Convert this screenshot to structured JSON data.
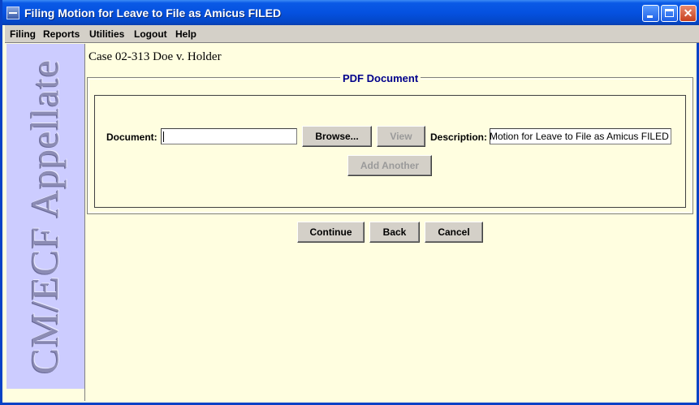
{
  "window": {
    "title": "Filing Motion for Leave to File as Amicus FILED"
  },
  "menu": {
    "items": [
      "Filing",
      "Reports",
      "Utilities",
      "Logout",
      "Help"
    ]
  },
  "sidebar": {
    "brand_text": "CM/ECF Appellate"
  },
  "case": {
    "title": "Case 02-313 Doe v. Holder"
  },
  "pdf_group": {
    "legend": "PDF Document",
    "document_label": "Document:",
    "document_value": "",
    "browse_label": "Browse...",
    "view_label": "View",
    "description_label": "Description:",
    "description_value": "Motion for Leave to File as Amicus FILED",
    "add_another_label": "Add Another"
  },
  "actions": {
    "continue_label": "Continue",
    "back_label": "Back",
    "cancel_label": "Cancel"
  }
}
